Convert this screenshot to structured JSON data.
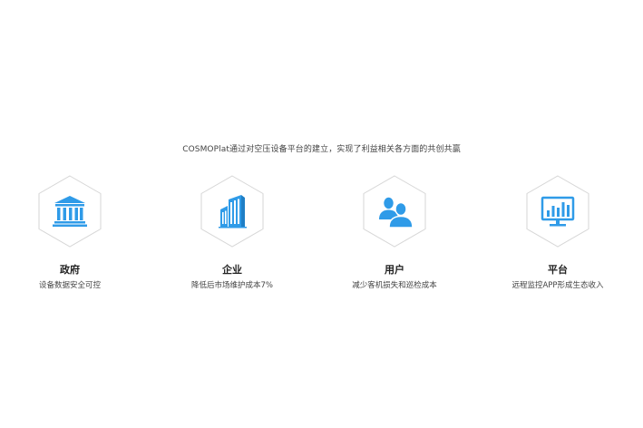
{
  "intro": "COSMOPlat通过对空压设备平台的建立，实现了利益相关各方面的共创共赢",
  "colors": {
    "accent": "#2f9be8",
    "hex_border": "#d6d6d6"
  },
  "cards": [
    {
      "icon": "government-building-icon",
      "title": "政府",
      "desc": "设备数据安全可控"
    },
    {
      "icon": "enterprise-buildings-icon",
      "title": "企业",
      "desc": "降低后市场维护成本7%"
    },
    {
      "icon": "users-icon",
      "title": "用户",
      "desc": "减少客机损失和巡检成本"
    },
    {
      "icon": "platform-monitor-chart-icon",
      "title": "平台",
      "desc": "远程监控APP形成生态收入"
    }
  ]
}
